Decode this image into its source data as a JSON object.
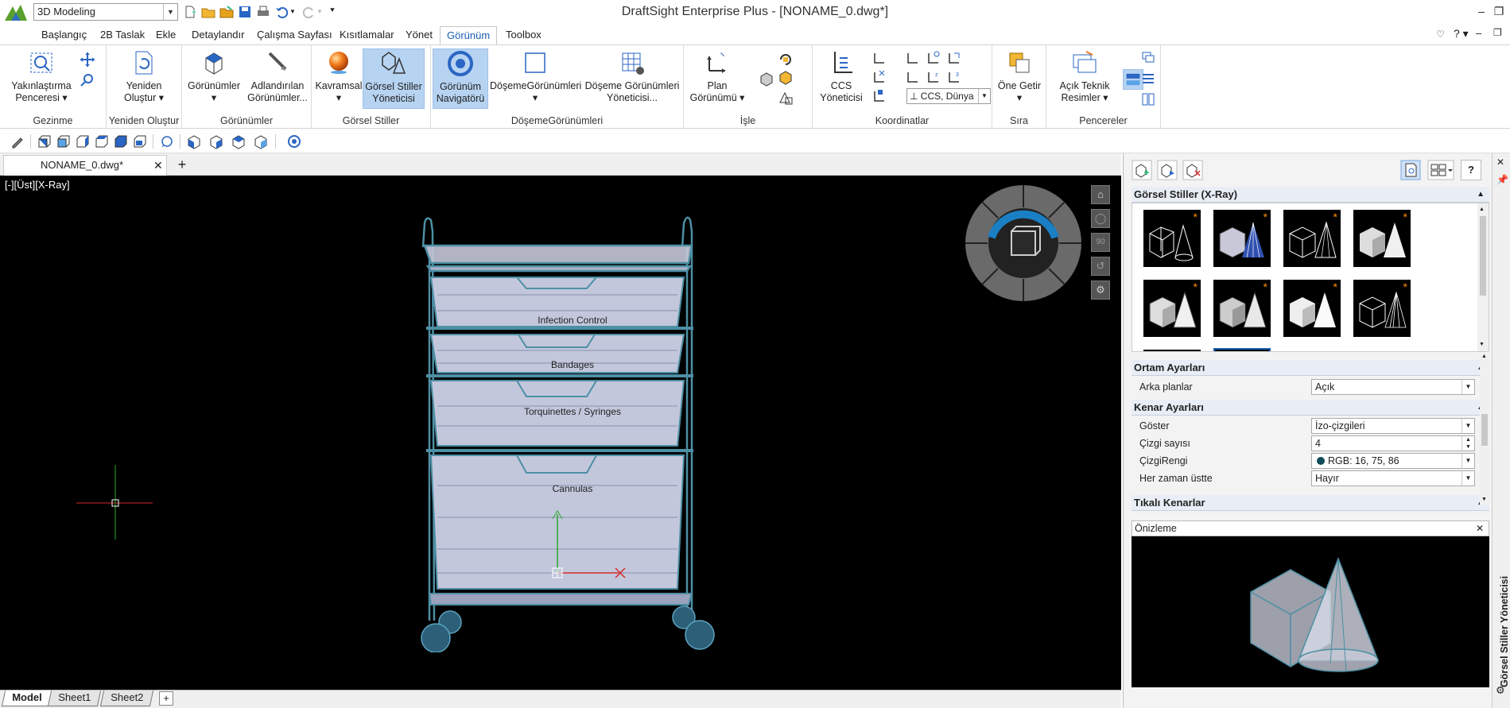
{
  "app": {
    "title": "DraftSight Enterprise Plus - [NONAME_0.dwg*]",
    "workspace": "3D Modeling"
  },
  "tabs": [
    "Başlangıç",
    "2B Taslak",
    "Ekle",
    "Detaylandır",
    "Çalışma Sayfası",
    "Kısıtlamalar",
    "Yönet",
    "Görünüm",
    "Toolbox"
  ],
  "active_tab": "Görünüm",
  "ribbon": {
    "groups": {
      "gezinme": "Gezinme",
      "yeniden": "Yeniden Oluştur",
      "gorunumler": "Görünümler",
      "gorsel": "Görsel Stiller",
      "doseme": "DöşemeGörünümleri",
      "isle": "İşle",
      "koordinatlar": "Koordinatlar",
      "sira": "Sıra",
      "pencereler": "Pencereler"
    },
    "buttons": {
      "yakinlastirma_1": "Yakınlaştırma",
      "yakinlastirma_2": "Penceresi",
      "yeniden_1": "Yeniden",
      "yeniden_2": "Oluştur",
      "gorunumler": "Görünümler",
      "adlandirilan_1": "Adlandırılan",
      "adlandirilan_2": "Görünümler...",
      "kavramsal": "Kavramsal",
      "gorsel_stiller_1": "Görsel Stiller",
      "gorsel_stiller_2": "Yöneticisi",
      "gorunum_nav_1": "Görünüm",
      "gorunum_nav_2": "Navigatörü",
      "doseme_gorunumleri": "DöşemeGörünümleri",
      "doseme_yon_1": "Döşeme Görünümleri",
      "doseme_yon_2": "Yöneticisi...",
      "plan_1": "Plan",
      "plan_2": "Görünümü",
      "ccs_1": "CCS",
      "ccs_2": "Yöneticisi",
      "ccs_select": "CCS, Dünya",
      "one_getir": "Öne Getir",
      "acik_teknik_1": "Açık Teknik",
      "acik_teknik_2": "Resimler"
    }
  },
  "document": {
    "tab": "NONAME_0.dwg*",
    "viewport_label": "[-][Üst][X-Ray]",
    "drawer_labels": [
      "Infection Control",
      "Bandages",
      "Torquinettes / Syringes",
      "Cannulas"
    ],
    "view_nav_value": "90"
  },
  "sheets": [
    "Model",
    "Sheet1",
    "Sheet2"
  ],
  "active_sheet": "Model",
  "panel": {
    "styles_header": "Görsel Stiller (X-Ray)",
    "ortam_header": "Ortam Ayarları",
    "arka_planlar_label": "Arka planlar",
    "arka_planlar_value": "Açık",
    "kenar_header": "Kenar Ayarları",
    "goster_label": "Göster",
    "goster_value": "İzo-çizgileri",
    "cizgi_sayisi_label": "Çizgi sayısı",
    "cizgi_sayisi_value": "4",
    "cizgi_rengi_label": "ÇizgiRengi",
    "cizgi_rengi_value": "RGB: 16, 75, 86",
    "cizgi_rengi_color": "#104b56",
    "her_zaman_label": "Her zaman üstte",
    "her_zaman_value": "Hayır",
    "tikali_header": "Tıkalı Kenarlar",
    "preview_title": "Önizleme",
    "side_title": "Görsel Stiller Yöneticisi"
  },
  "colors": {
    "accent": "#1a5fb4",
    "selected": "#b6d3f2",
    "wire": "#4d8fa4"
  }
}
